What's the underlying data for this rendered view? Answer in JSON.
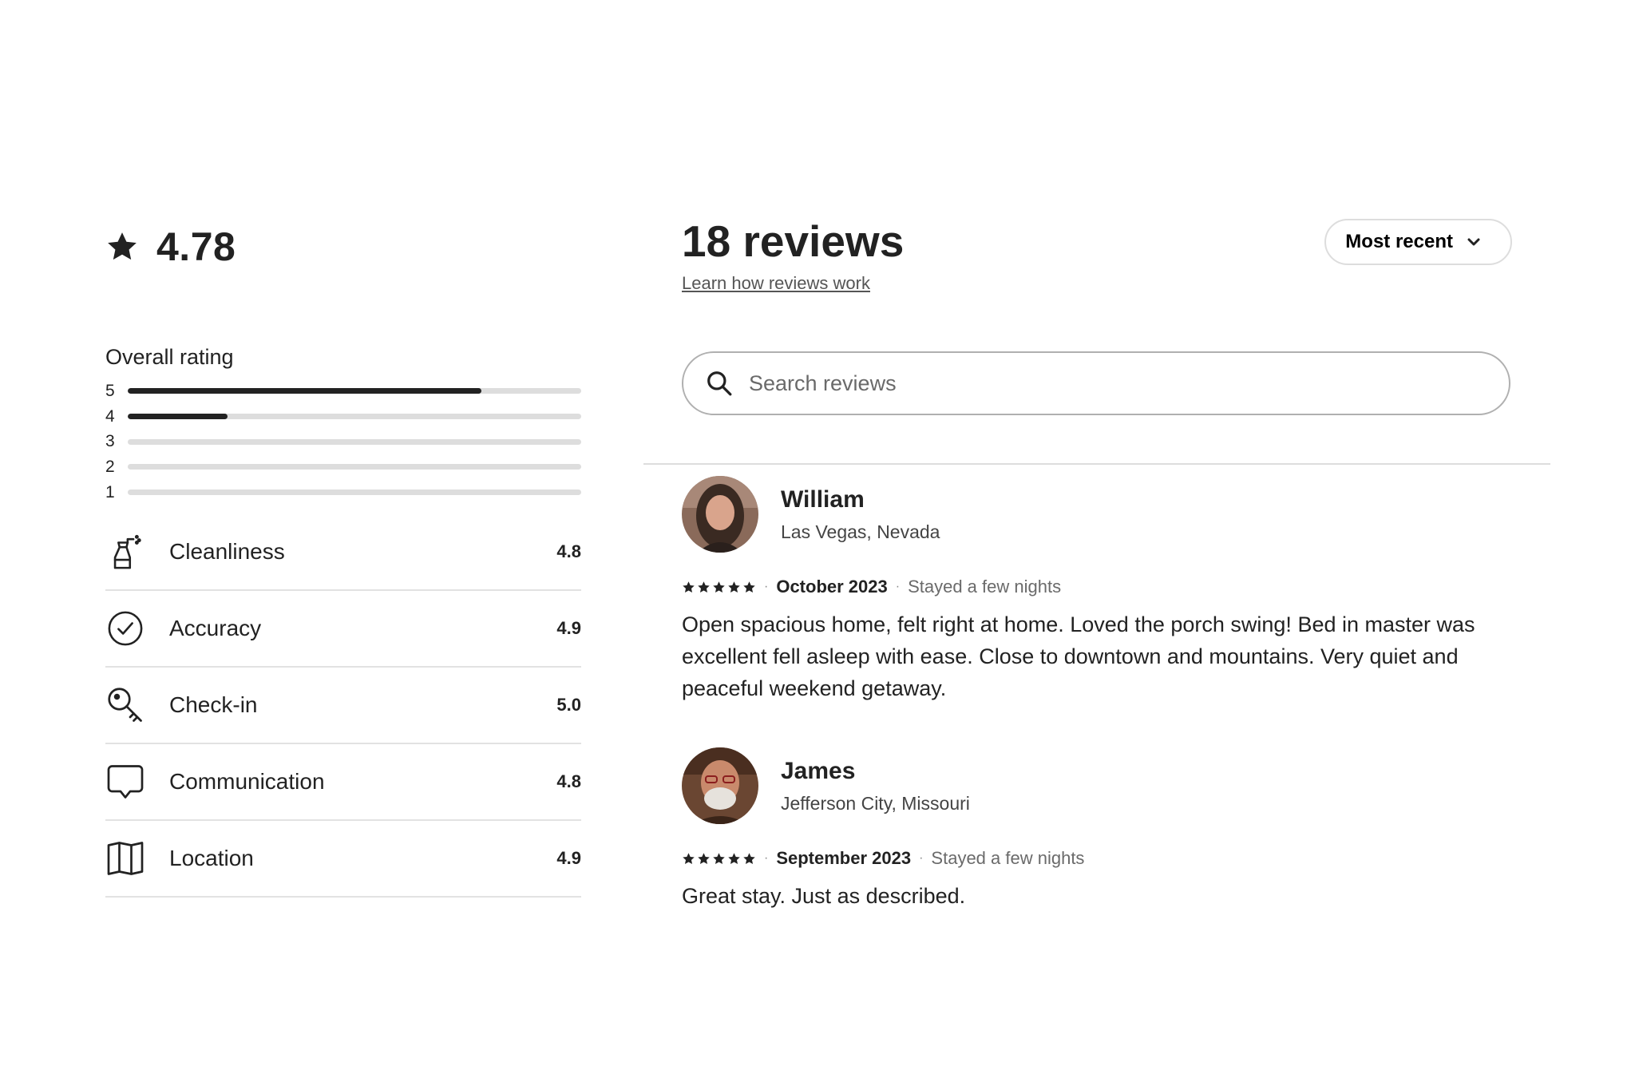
{
  "summary": {
    "score": "4.78",
    "overall_title": "Overall rating",
    "distribution": [
      {
        "stars": "5",
        "share": 0.78
      },
      {
        "stars": "4",
        "share": 0.22
      },
      {
        "stars": "3",
        "share": 0.0
      },
      {
        "stars": "2",
        "share": 0.0
      },
      {
        "stars": "1",
        "share": 0.0
      }
    ],
    "categories": [
      {
        "label": "Cleanliness",
        "value": "4.8",
        "icon": "spray-bottle-icon"
      },
      {
        "label": "Accuracy",
        "value": "4.9",
        "icon": "check-circle-icon"
      },
      {
        "label": "Check-in",
        "value": "5.0",
        "icon": "key-icon"
      },
      {
        "label": "Communication",
        "value": "4.8",
        "icon": "speech-bubble-icon"
      },
      {
        "label": "Location",
        "value": "4.9",
        "icon": "map-icon"
      }
    ]
  },
  "header": {
    "title": "18 reviews",
    "learn_link": "Learn how reviews work",
    "sort_label": "Most recent"
  },
  "search": {
    "placeholder": "Search reviews"
  },
  "reviews": [
    {
      "name": "William",
      "location": "Las Vegas, Nevada",
      "stars": 5,
      "date": "October 2023",
      "stay": "Stayed a few nights",
      "text": "Open spacious home, felt right at home. Loved the porch swing! Bed in master was excellent fell asleep with ease. Close to downtown and mountains. Very quiet and peaceful weekend getaway."
    },
    {
      "name": "James",
      "location": "Jefferson City, Missouri",
      "stars": 5,
      "date": "September 2023",
      "stay": "Stayed a few nights",
      "text": "Great stay. Just as described."
    }
  ],
  "colors": {
    "text": "#222222",
    "muted": "#6a6a6a",
    "track": "#dddddd",
    "divider": "#e2e2e2"
  }
}
